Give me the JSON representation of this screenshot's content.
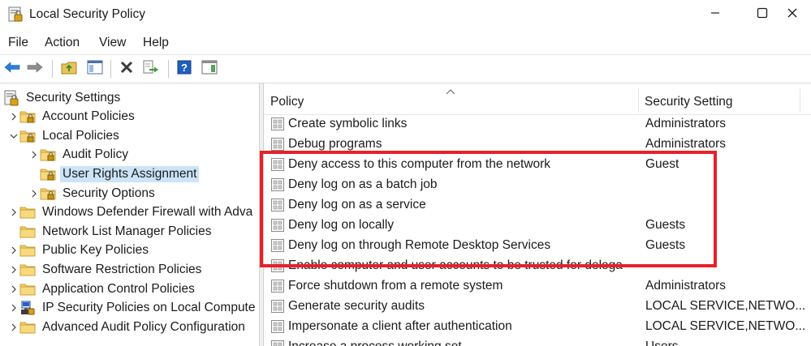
{
  "window": {
    "title": "Local Security Policy",
    "icon": "security-policy-icon"
  },
  "menu": [
    {
      "label": "File"
    },
    {
      "label": "Action"
    },
    {
      "label": "View"
    },
    {
      "label": "Help"
    }
  ],
  "toolbar": [
    {
      "name": "back-arrow-icon"
    },
    {
      "name": "forward-arrow-icon"
    },
    {
      "name": "up-folder-icon"
    },
    {
      "name": "show-hide-console-tree-icon"
    },
    {
      "name": "delete-icon"
    },
    {
      "name": "export-list-icon"
    },
    {
      "name": "help-icon"
    },
    {
      "name": "show-action-pane-icon"
    }
  ],
  "tree": [
    {
      "label": "Security Settings",
      "icon": "security-settings-icon",
      "level": 0,
      "expander": "none"
    },
    {
      "label": "Account Policies",
      "icon": "folder-lock-icon",
      "level": 1,
      "expander": "collapsed"
    },
    {
      "label": "Local Policies",
      "icon": "folder-lock-icon",
      "level": 1,
      "expander": "expanded"
    },
    {
      "label": "Audit Policy",
      "icon": "folder-lock-icon",
      "level": 2,
      "expander": "collapsed"
    },
    {
      "label": "User Rights Assignment",
      "icon": "folder-lock-icon",
      "level": 2,
      "expander": "none",
      "selected": true
    },
    {
      "label": "Security Options",
      "icon": "folder-lock-icon",
      "level": 2,
      "expander": "collapsed"
    },
    {
      "label": "Windows Defender Firewall with Adva",
      "icon": "folder-icon",
      "level": 1,
      "expander": "collapsed"
    },
    {
      "label": "Network List Manager Policies",
      "icon": "folder-icon",
      "level": 1,
      "expander": "none"
    },
    {
      "label": "Public Key Policies",
      "icon": "folder-icon",
      "level": 1,
      "expander": "collapsed"
    },
    {
      "label": "Software Restriction Policies",
      "icon": "folder-icon",
      "level": 1,
      "expander": "collapsed"
    },
    {
      "label": "Application Control Policies",
      "icon": "folder-icon",
      "level": 1,
      "expander": "collapsed"
    },
    {
      "label": "IP Security Policies on Local Compute",
      "icon": "ip-security-icon",
      "level": 1,
      "expander": "collapsed"
    },
    {
      "label": "Advanced Audit Policy Configuration",
      "icon": "folder-icon",
      "level": 1,
      "expander": "collapsed"
    }
  ],
  "list": {
    "columns": {
      "policy": "Policy",
      "setting": "Security Setting"
    },
    "rows": [
      {
        "policy": "Create symbolic links",
        "setting": "Administrators"
      },
      {
        "policy": "Debug programs",
        "setting": "Administrators"
      },
      {
        "policy": "Deny access to this computer from the network",
        "setting": "Guest"
      },
      {
        "policy": "Deny log on as a batch job",
        "setting": ""
      },
      {
        "policy": "Deny log on as a service",
        "setting": ""
      },
      {
        "policy": "Deny log on locally",
        "setting": "Guests"
      },
      {
        "policy": "Deny log on through Remote Desktop Services",
        "setting": "Guests"
      },
      {
        "policy": "Enable computer and user accounts to be trusted for delega",
        "setting": ""
      },
      {
        "policy": "Force shutdown from a remote system",
        "setting": "Administrators"
      },
      {
        "policy": "Generate security audits",
        "setting": "LOCAL SERVICE,NETWO..."
      },
      {
        "policy": "Impersonate a client after authentication",
        "setting": "LOCAL SERVICE,NETWO..."
      },
      {
        "policy": "Increase a process working set",
        "setting": "Users"
      }
    ]
  },
  "annotation": {
    "color": "#e8202a"
  }
}
